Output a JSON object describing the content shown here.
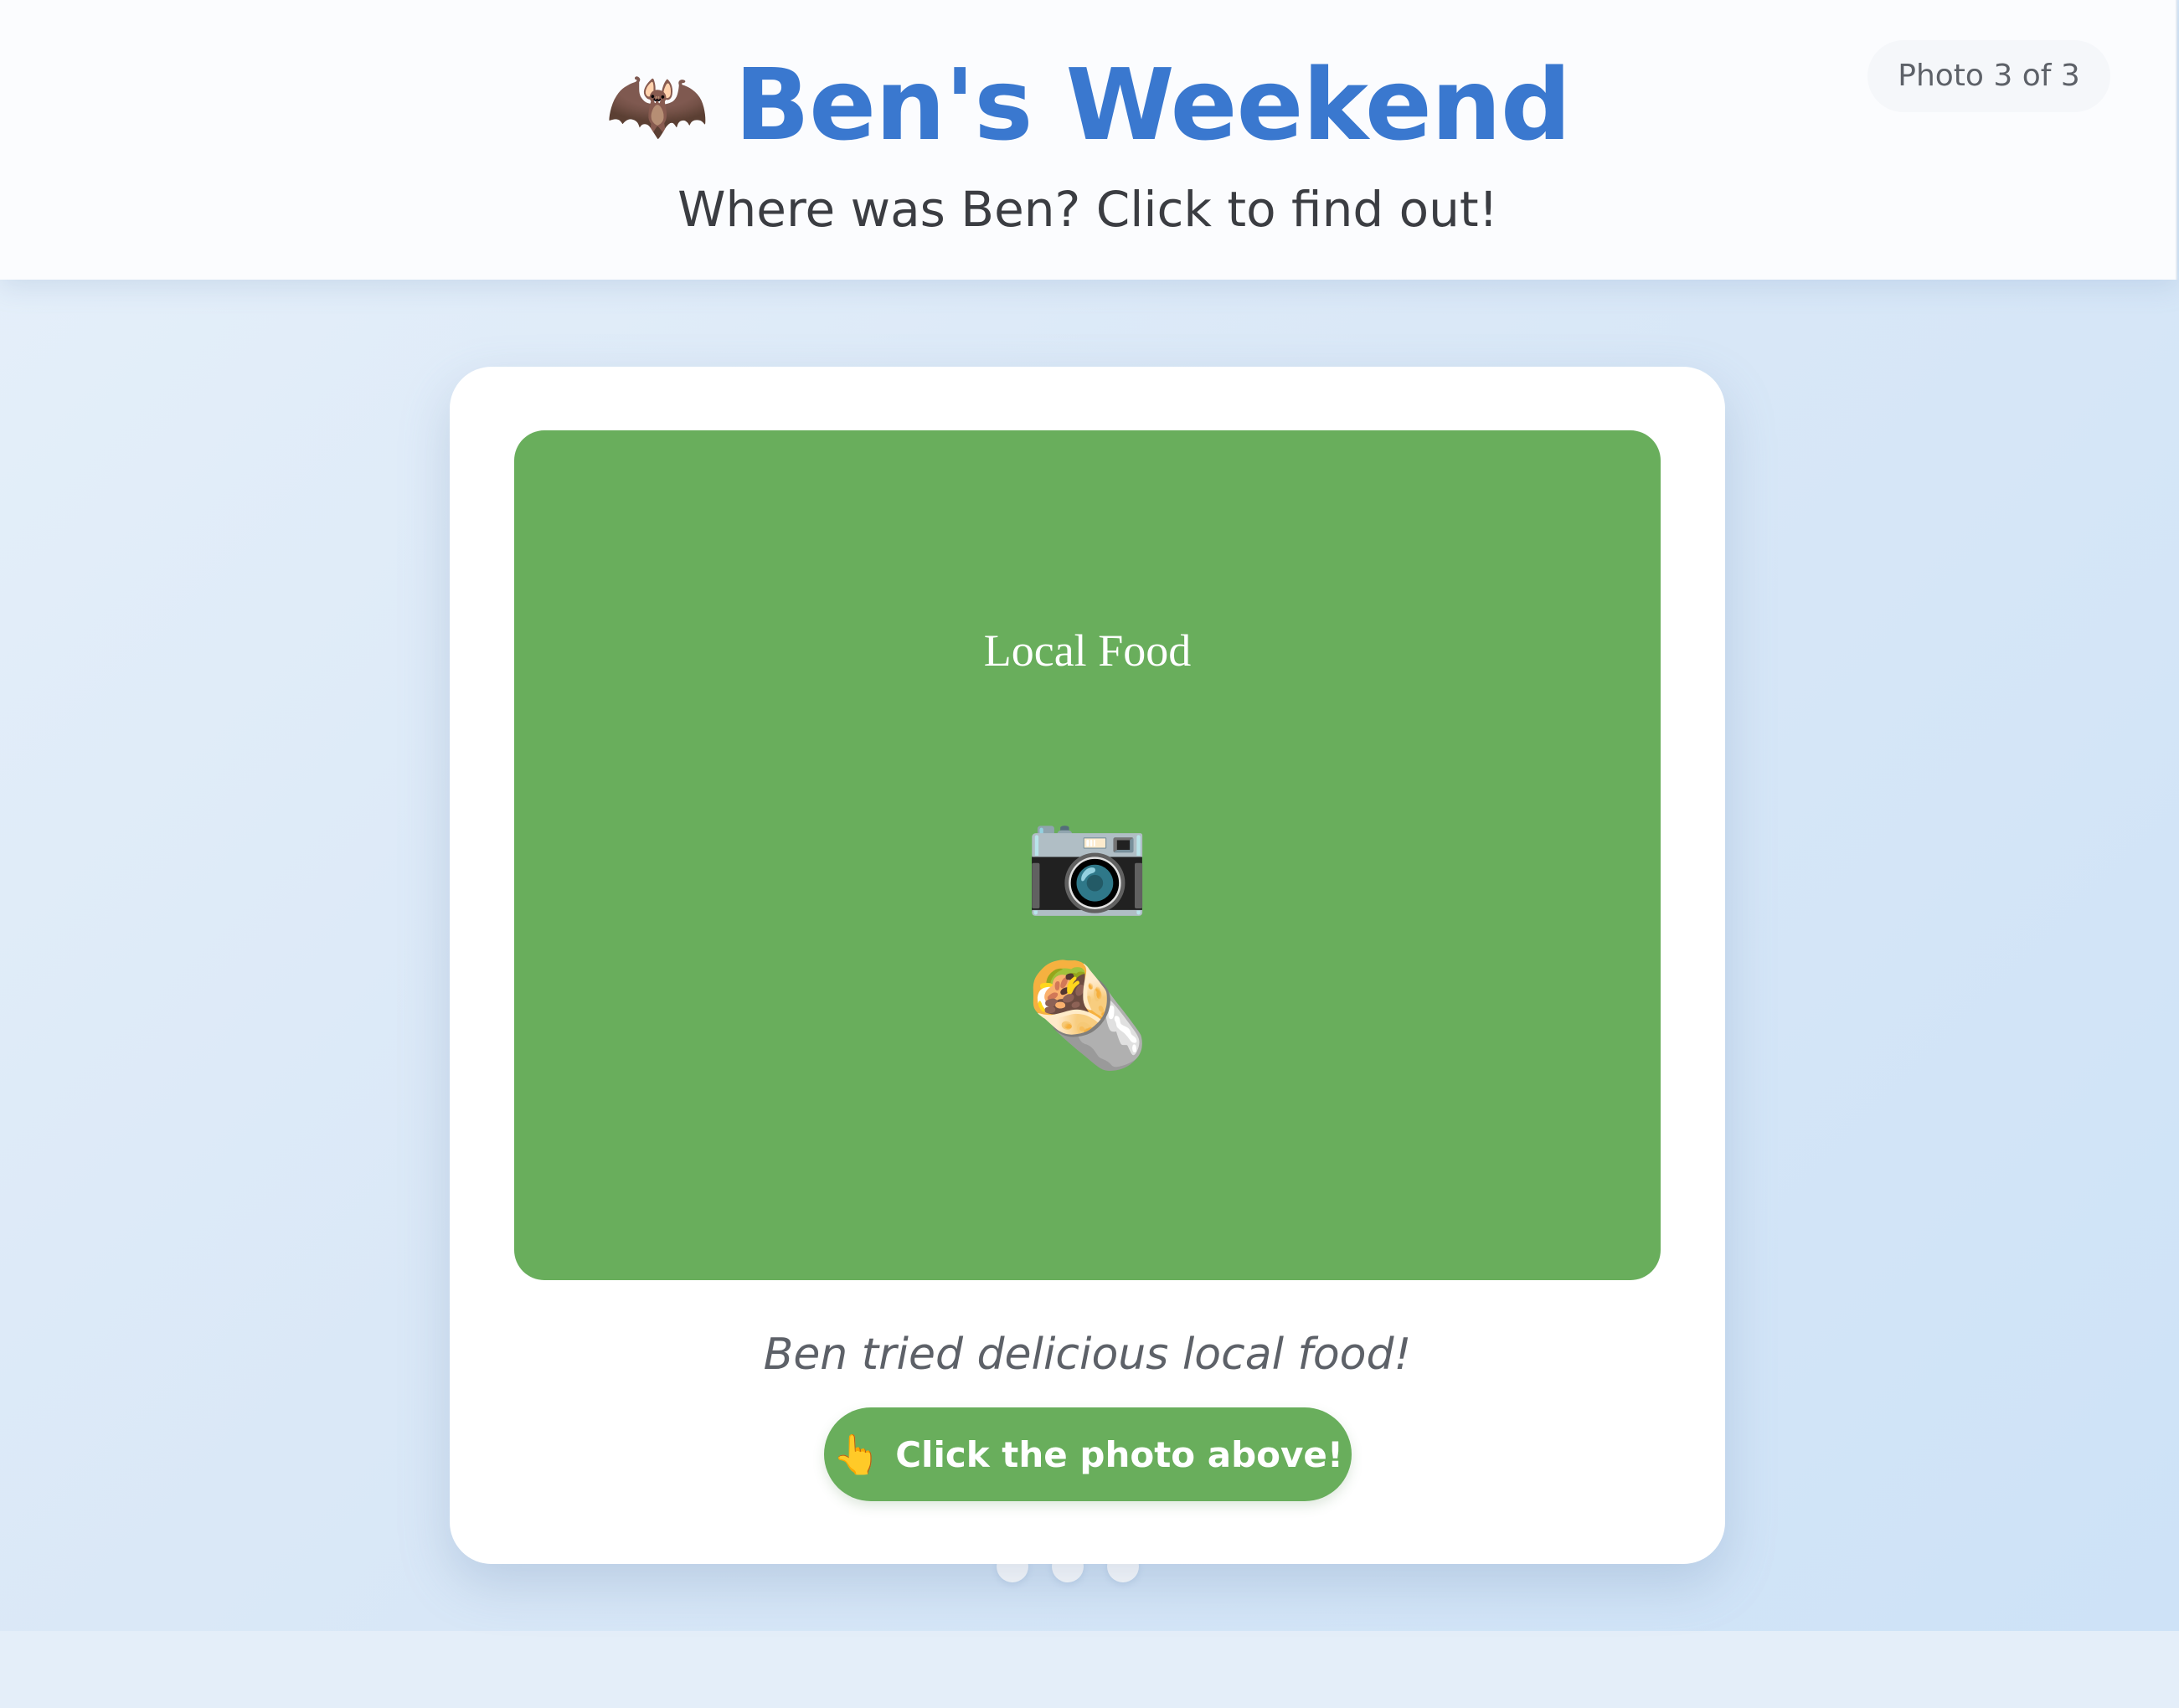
{
  "header": {
    "title_emoji": "🦇",
    "title": "Ben's Weekend",
    "subtitle": "Where was Ben? Click to find out!",
    "photo_counter": "Photo 3 of 3"
  },
  "photo": {
    "title": "Local Food",
    "camera_emoji": "📷",
    "food_emoji": "🌯",
    "background_color": "#69ae5c"
  },
  "caption": "Ben tried delicious local food!",
  "cta": {
    "icon": "👆",
    "label": "Click the photo above!"
  },
  "pagination": {
    "total": 3,
    "active_index": 3
  },
  "colors": {
    "accent_blue": "#3a78cf",
    "accent_green": "#69ae5c"
  }
}
